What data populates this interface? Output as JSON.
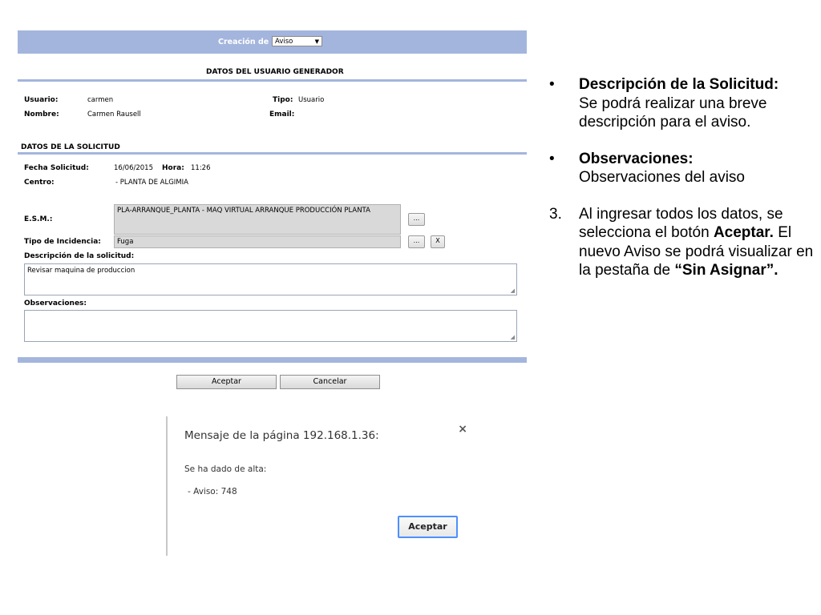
{
  "form": {
    "header": {
      "title": "Creación de",
      "select_value": "Aviso"
    },
    "user_section": {
      "title": "DATOS DEL USUARIO GENERADOR",
      "usuario_label": "Usuario:",
      "usuario_value": "carmen",
      "tipo_label": "Tipo:",
      "tipo_value": "Usuario",
      "nombre_label": "Nombre:",
      "nombre_value": "Carmen Rausell",
      "email_label": "Email:",
      "email_value": ""
    },
    "request_section": {
      "title": "DATOS DE LA SOLICITUD",
      "fecha_label": "Fecha Solicitud:",
      "fecha_value": "16/06/2015",
      "hora_label": "Hora:",
      "hora_value": "11:26",
      "centro_label": "Centro:",
      "centro_value": "- PLANTA DE ALGIMIA",
      "esm_label": "E.S.M.:",
      "esm_value": "PLA-ARRANQUE_PLANTA - MAQ VIRTUAL ARRANQUE PRODUCCIÓN PLANTA",
      "esm_button": "...",
      "incidencia_label": "Tipo de Incidencia:",
      "incidencia_value": "Fuga",
      "incidencia_button": "...",
      "incidencia_clear": "X",
      "descripcion_label": "Descripción de la solicitud:",
      "descripcion_value": "Revisar maquina de produccion",
      "observaciones_label": "Observaciones:",
      "observaciones_value": ""
    },
    "buttons": {
      "accept": "Aceptar",
      "cancel": "Cancelar"
    }
  },
  "dialog": {
    "title": "Mensaje de la página 192.168.1.36:",
    "close": "×",
    "line1": "Se ha dado de alta:",
    "line2": "- Aviso: 748",
    "ok_button": "Aceptar"
  },
  "notes": {
    "item1": {
      "bullet": "•",
      "title": "Descripción de la Solicitud:",
      "text": "Se podrá realizar una breve descripción para el aviso."
    },
    "item2": {
      "bullet": "•",
      "title": "Observaciones:",
      "text": "Observaciones del aviso"
    },
    "item3": {
      "bullet": "3.",
      "text_a": "Al ingresar todos los datos, se selecciona el botón",
      "bold_a": "Aceptar.",
      "text_b": "El nuevo Aviso se podrá visualizar en la pestaña de",
      "bold_b": "“Sin Asignar”."
    }
  }
}
